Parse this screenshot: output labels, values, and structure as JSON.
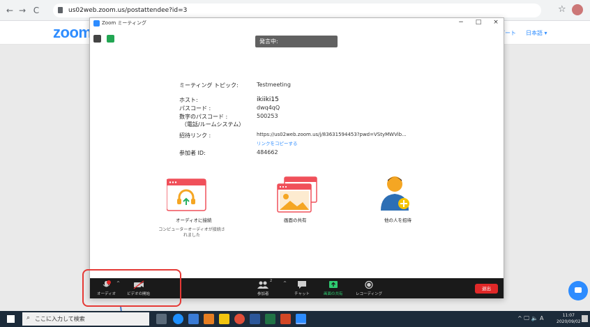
{
  "browser": {
    "url": "us02web.zoom.us/postattendee?id=3",
    "back_icon": "←",
    "forward_icon": "→",
    "reload_icon": "C",
    "star_icon": "☆"
  },
  "page": {
    "logo": "zoom",
    "support_link": "ポート",
    "language": "日本語 ▾"
  },
  "window": {
    "title": "Zoom ミーティング",
    "controls": {
      "minimize": "−",
      "maximize": "□",
      "close": "×"
    },
    "talking_label": "発言中:"
  },
  "meeting_info": {
    "topic_label": "ミーティング トピック:",
    "topic_value": "Testmeeting",
    "host_label": "ホスト:",
    "host_value": "ikiiki15",
    "passcode_label": "パスコード :",
    "passcode_value": "dwq4qQ",
    "numeric_passcode_label": "数字のパスコード :",
    "numeric_passcode_sub": "（電話/ルームシステム）",
    "numeric_passcode_value": "500253",
    "invite_link_label": "招待リンク :",
    "invite_link_value": "https://us02web.zoom.us/j/83631594453?pwd=VStyMWVib...",
    "copy_link": "リンクをコピーする",
    "participant_id_label": "参加者 ID:",
    "participant_id_value": "484662"
  },
  "big_buttons": {
    "audio": "オーディオに接続",
    "share": "画面の共有",
    "invite": "他の人を招待",
    "audio_status": "コンピューターオーディオが接続されました"
  },
  "toolbar": {
    "audio": "オーディオ",
    "video": "ビデオの開始",
    "participants": "参加者",
    "participants_count": "2",
    "chat": "チャット",
    "share": "画面の共有",
    "record": "レコーディング",
    "leave": "退出",
    "caret": "^"
  },
  "taskbar": {
    "search_placeholder": "ここに入力して検索",
    "tray_text": "^ 🖵 🔈 A",
    "time": "11:07",
    "date": "2020/09/02"
  },
  "colors": {
    "zoom_blue": "#2d8cff",
    "leave_red": "#e02828",
    "share_green": "#2ecc71",
    "illustration_red": "#f0505a"
  }
}
